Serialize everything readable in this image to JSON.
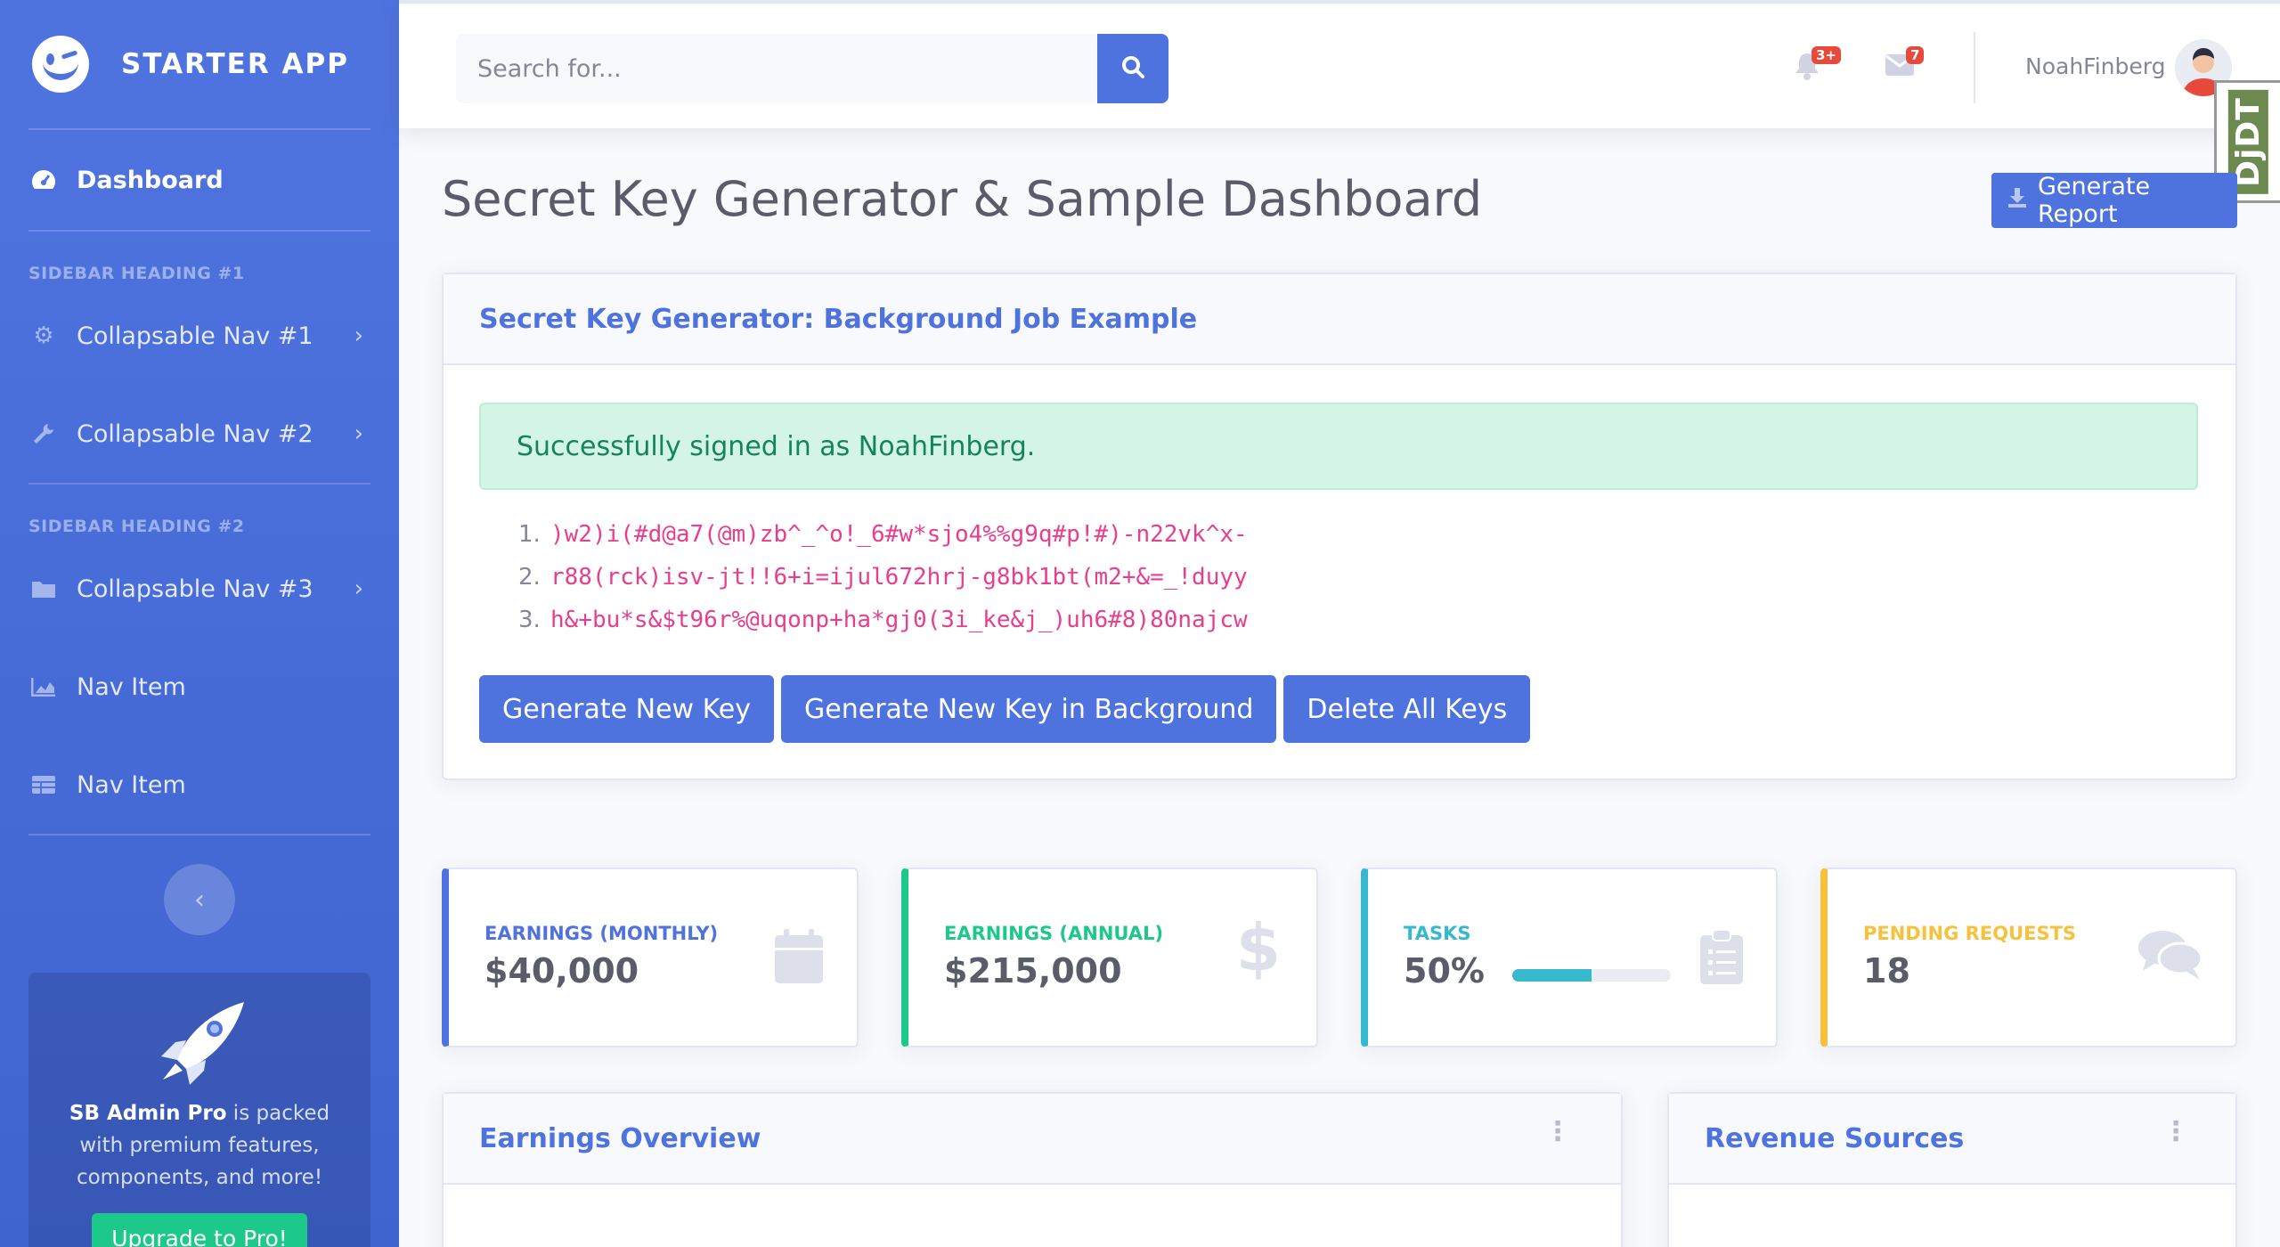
{
  "brand": {
    "name": "STARTER APP"
  },
  "sidebar": {
    "dashboard": "Dashboard",
    "heading1": "SIDEBAR HEADING #1",
    "nav1": "Collapsable Nav #1",
    "nav2": "Collapsable Nav #2",
    "heading2": "SIDEBAR HEADING #2",
    "nav3": "Collapsable Nav #3",
    "nav4": "Nav Item",
    "nav5": "Nav Item",
    "promo_bold": "SB Admin Pro",
    "promo_text": " is packed with premium features, components, and more!",
    "promo_button": "Upgrade to Pro!"
  },
  "topbar": {
    "search_placeholder": "Search for...",
    "alerts_badge": "3+",
    "messages_badge": "7",
    "user_name": "NoahFinberg",
    "debug_toolbar": "DjDT"
  },
  "page": {
    "title": "Secret Key Generator & Sample Dashboard",
    "report_button": "Generate Report"
  },
  "keygen": {
    "header": "Secret Key Generator: Background Job Example",
    "alert": "Successfully signed in as NoahFinberg.",
    "keys": [
      ")w2)i(#d@a7(@m)zb^_^o!_6#w*sjo4%%g9q#p!#)-n22vk^x-",
      "r88(rck)isv-jt!!6+i=ijul672hrj-g8bk1bt(m2+&=_!duyy",
      "h&+bu*s&$t96r%@uqonp+ha*gj0(3i_ke&j_)uh6#8)80najcw"
    ],
    "btn_generate": "Generate New Key",
    "btn_background": "Generate New Key in Background",
    "btn_delete": "Delete All Keys"
  },
  "stats": [
    {
      "label": "EARNINGS (MONTHLY)",
      "value": "$40,000",
      "color": "#4e73df",
      "icon": "calendar-icon"
    },
    {
      "label": "EARNINGS (ANNUAL)",
      "value": "$215,000",
      "color": "#1cc88a",
      "icon": "dollar-icon"
    },
    {
      "label": "TASKS",
      "value": "50%",
      "progress": 0.5,
      "color": "#36b9cc",
      "icon": "clipboard-list-icon"
    },
    {
      "label": "PENDING REQUESTS",
      "value": "18",
      "color": "#f6c23e",
      "icon": "comments-icon"
    }
  ],
  "panels": {
    "earnings": "Earnings Overview",
    "revenue": "Revenue Sources"
  }
}
